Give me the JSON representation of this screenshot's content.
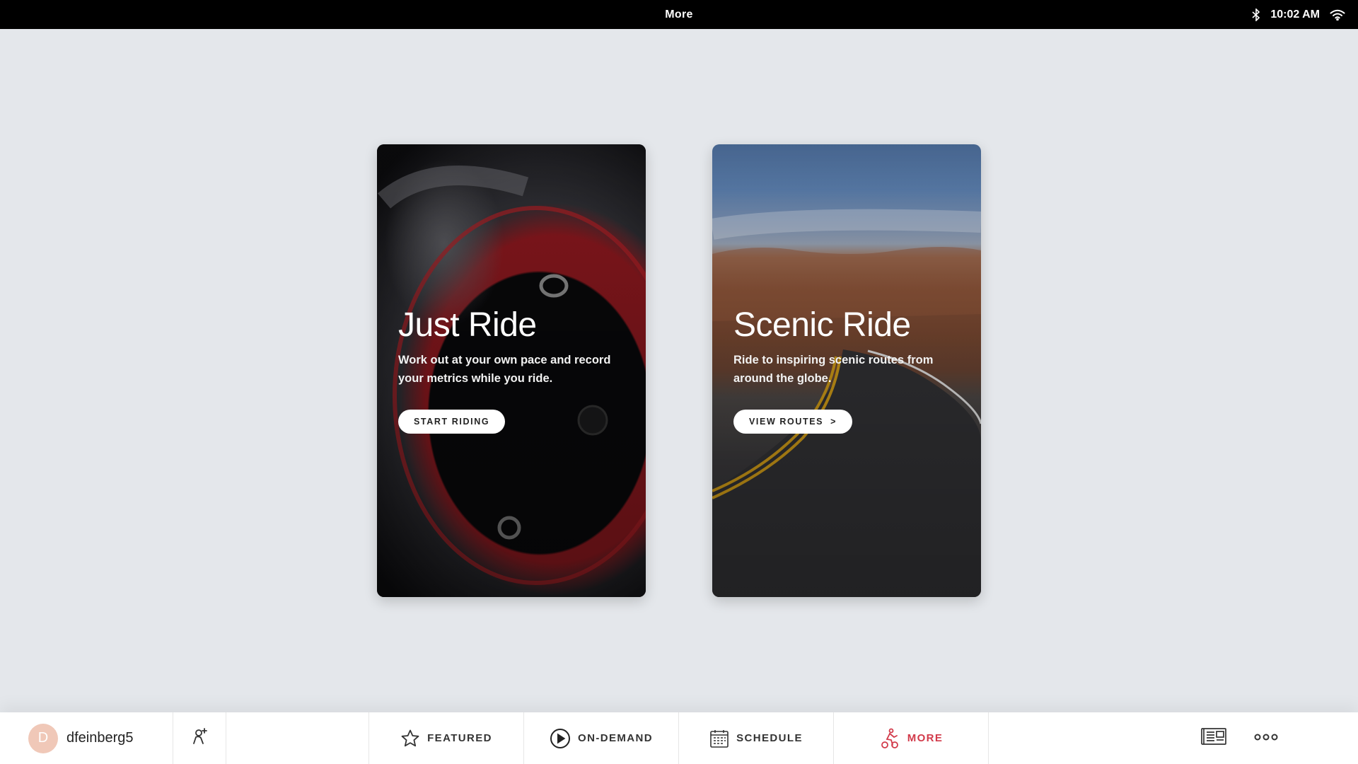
{
  "status_bar": {
    "title": "More",
    "time": "10:02 AM",
    "icons": [
      "bluetooth-icon",
      "wifi-icon"
    ]
  },
  "cards": [
    {
      "id": "just-ride",
      "title": "Just Ride",
      "description": "Work out at your own pace and record your metrics while you ride.",
      "button_label": "START RIDING"
    },
    {
      "id": "scenic-ride",
      "title": "Scenic Ride",
      "description": "Ride to inspiring scenic routes from around the globe.",
      "button_label": "VIEW ROUTES",
      "button_suffix": ">"
    }
  ],
  "bottom_nav": {
    "username": "dfeinberg5",
    "avatar_initial": "D",
    "items": [
      {
        "label": "FEATURED",
        "icon": "star-icon"
      },
      {
        "label": "ON-DEMAND",
        "icon": "play-circle-icon"
      },
      {
        "label": "SCHEDULE",
        "icon": "calendar-icon"
      },
      {
        "label": "MORE",
        "icon": "rider-icon",
        "active": true
      }
    ],
    "right_icons": [
      "newspaper-icon",
      "more-dots-icon"
    ]
  },
  "colors": {
    "accent": "#d23a4a",
    "background": "#e4e7eb",
    "status_bar": "#000000"
  }
}
